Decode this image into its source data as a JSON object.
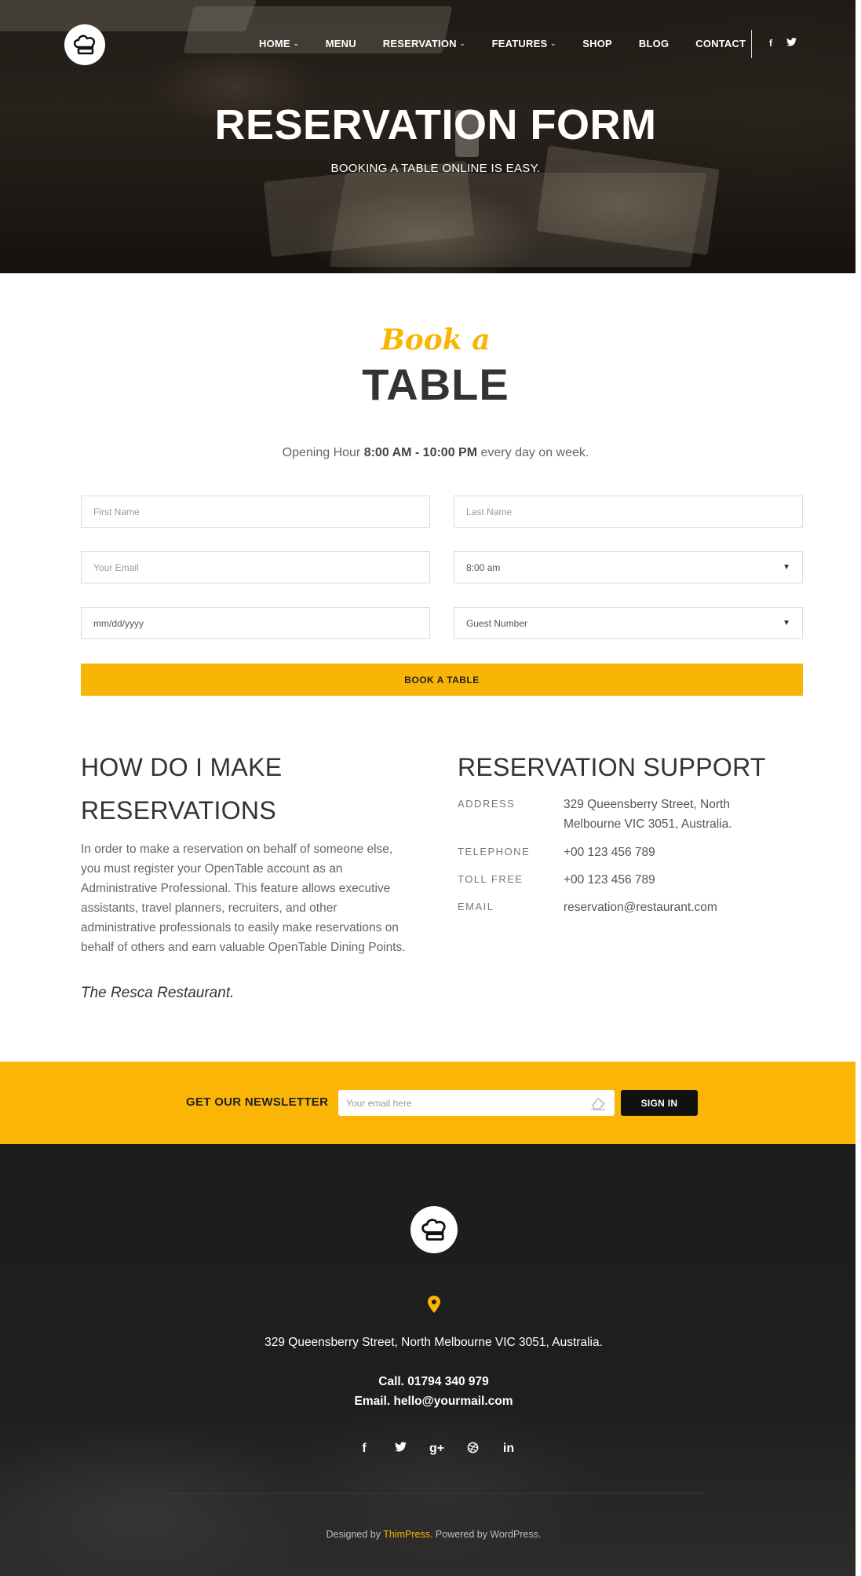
{
  "nav": {
    "items": [
      {
        "label": "HOME",
        "has_dropdown": true
      },
      {
        "label": "MENU",
        "has_dropdown": false
      },
      {
        "label": "RESERVATION",
        "has_dropdown": true
      },
      {
        "label": "FEATURES",
        "has_dropdown": true
      },
      {
        "label": "SHOP",
        "has_dropdown": false
      },
      {
        "label": "BLOG",
        "has_dropdown": false
      },
      {
        "label": "CONTACT",
        "has_dropdown": false
      }
    ],
    "social": {
      "facebook": "f",
      "twitter": "t"
    }
  },
  "hero": {
    "title": "RESERVATION FORM",
    "subtitle": "BOOKING A TABLE ONLINE IS EASY."
  },
  "booking": {
    "script_title": "Book a",
    "title": "TABLE",
    "opening_prefix": "Opening Hour ",
    "opening_hours": "8:00 AM - 10:00 PM",
    "opening_suffix": " every day on week.",
    "first_name_placeholder": "First Name",
    "last_name_placeholder": "Last Name",
    "email_placeholder": "Your Email",
    "time_value": "8:00 am",
    "date_placeholder": "mm/dd/yyyy",
    "guest_value": "Guest Number",
    "submit_label": "BOOK A TABLE"
  },
  "how": {
    "title_line1": "HOW DO I MAKE",
    "title_line2": "RESERVATIONS",
    "text": "In order to make a reservation on behalf of someone else, you must register your OpenTable account as an Administrative Professional. This feature allows executive assistants, travel planners, recruiters, and other administrative professionals to easily make reservations on behalf of others and earn valuable OpenTable Dining Points.",
    "signature": "The Resca Restaurant."
  },
  "support": {
    "title": "RESERVATION SUPPORT",
    "address_label": "ADDRESS",
    "address_value": "329 Queensberry Street, North Melbourne VIC 3051, Australia.",
    "telephone_label": "TELEPHONE",
    "telephone_value": "+00 123 456 789",
    "tollfree_label": "TOLL FREE",
    "tollfree_value": "+00 123 456 789",
    "email_label": "EMAIL",
    "email_value": "reservation@restaurant.com"
  },
  "newsletter": {
    "label": "GET OUR NEWSLETTER",
    "placeholder": "Your email here",
    "button": "SIGN IN"
  },
  "footer": {
    "address": "329 Queensberry Street, North Melbourne VIC 3051, Australia.",
    "call": "Call. 01794 340 979",
    "email": "Email. hello@yourmail.com",
    "credit_prefix": "Designed by ",
    "credit_brand": "ThimPress",
    "credit_suffix": ". Powered by WordPress."
  },
  "colors": {
    "accent": "#f9b506",
    "dark": "#1c1c1c"
  }
}
